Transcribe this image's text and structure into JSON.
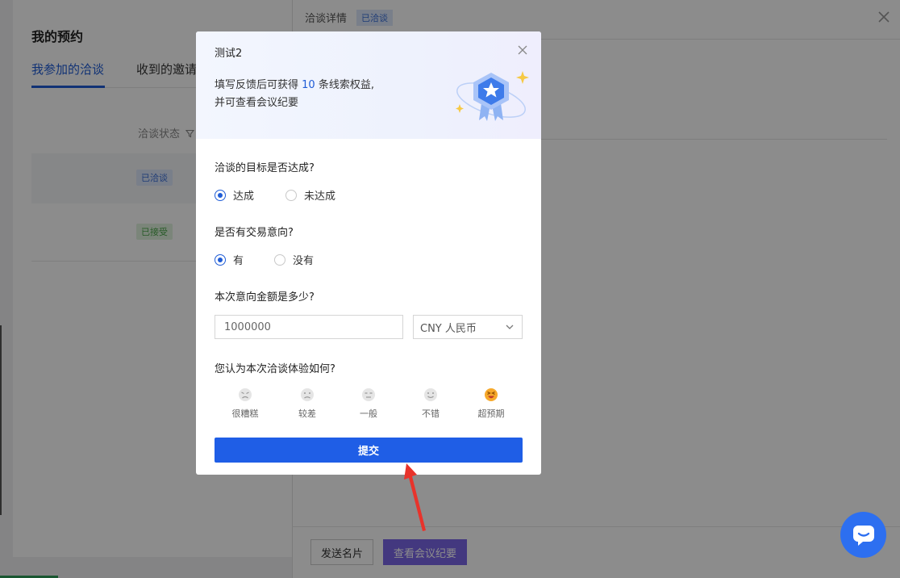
{
  "background": {
    "page_title": "我的预约",
    "tabs": [
      "我参加的洽谈",
      "收到的邀请"
    ],
    "column_header": "洽谈状态",
    "status_badges": [
      "已洽谈",
      "已接受"
    ],
    "detail_title": "洽谈详情",
    "detail_badge": "已洽谈",
    "footer_buttons": [
      "发送名片",
      "查看会议纪要"
    ]
  },
  "modal": {
    "title": "测试2",
    "desc_prefix": "填写反馈后可获得 ",
    "desc_count": "10",
    "desc_suffix": " 条线索权益,",
    "desc_line2": "并可查看会议纪要",
    "q1": {
      "label": "洽谈的目标是否达成?",
      "options": [
        "达成",
        "未达成"
      ],
      "selected": "达成"
    },
    "q2": {
      "label": "是否有交易意向?",
      "options": [
        "有",
        "没有"
      ],
      "selected": "有"
    },
    "q3": {
      "label": "本次意向金额是多少?",
      "amount": "1000000",
      "currency": "CNY 人民币"
    },
    "q4": {
      "label": "您认为本次洽谈体验如何?",
      "ratings": [
        "很糟糕",
        "较差",
        "一般",
        "不错",
        "超预期"
      ],
      "selected": "超预期"
    },
    "submit_label": "提交"
  },
  "colors": {
    "accent": "#1f5ee6",
    "purple_button": "#7b66e8",
    "arrow": "#e8332b"
  },
  "icons": [
    "close-icon",
    "medal-icon",
    "filter-icon",
    "chevron-down-icon",
    "chat-icon"
  ]
}
